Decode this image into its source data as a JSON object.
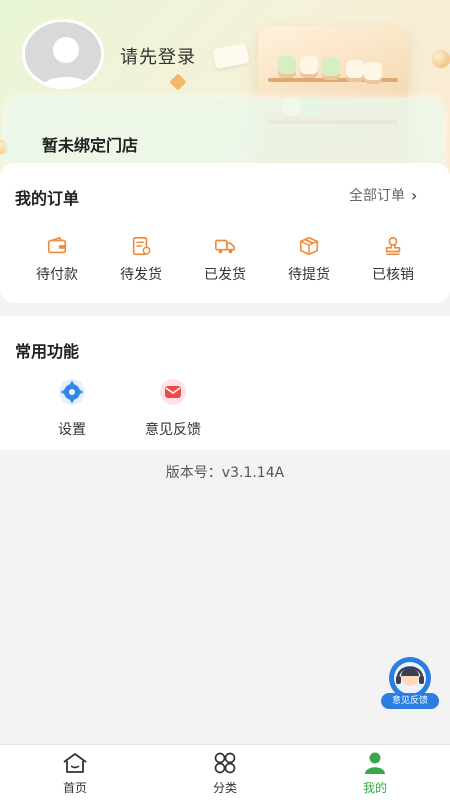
{
  "header": {
    "login_prompt": "请先登录",
    "store_status": "暂未绑定门店"
  },
  "orders": {
    "title": "我的订单",
    "all_orders": "全部订单",
    "items": [
      {
        "label": "待付款",
        "icon": "wallet-icon"
      },
      {
        "label": "待发货",
        "icon": "receipt-icon"
      },
      {
        "label": "已发货",
        "icon": "truck-icon"
      },
      {
        "label": "待提货",
        "icon": "package-icon"
      },
      {
        "label": "已核销",
        "icon": "stamp-icon"
      }
    ]
  },
  "functions": {
    "title": "常用功能",
    "items": [
      {
        "label": "设置",
        "icon": "gear-icon"
      },
      {
        "label": "意见反馈",
        "icon": "envelope-icon"
      }
    ]
  },
  "version_text": "版本号：v3.1.14A",
  "floating_feedback": {
    "label": "意见反馈",
    "icon": "headset-icon"
  },
  "tabbar": {
    "tabs": [
      {
        "label": "首页",
        "icon": "home-icon",
        "active": false
      },
      {
        "label": "分类",
        "icon": "category-icon",
        "active": false
      },
      {
        "label": "我的",
        "icon": "user-icon",
        "active": true
      }
    ]
  },
  "colors": {
    "accent_orange": "#f08a3c",
    "active_green": "#3aa64a",
    "feedback_blue": "#2a7de1"
  }
}
